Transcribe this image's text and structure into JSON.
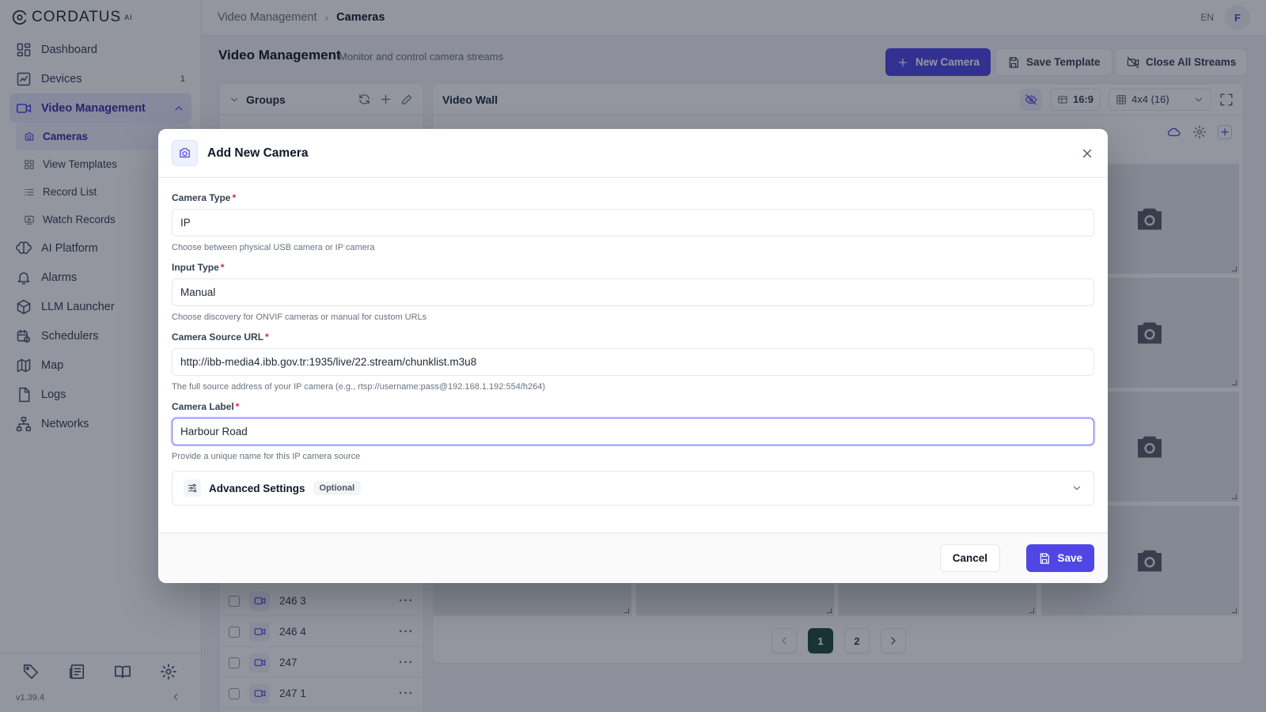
{
  "app": {
    "brand": "CORDATUS",
    "brand_sup": "AI",
    "version": "v1.39.4"
  },
  "sidebar": {
    "items": [
      {
        "label": "Dashboard",
        "icon": "dashboard-icon"
      },
      {
        "label": "Devices",
        "icon": "devices-icon",
        "badge": "1"
      },
      {
        "label": "Video Management",
        "icon": "video-icon",
        "active": true
      },
      {
        "label": "AI Platform",
        "icon": "brain-icon"
      },
      {
        "label": "Alarms",
        "icon": "bell-icon"
      },
      {
        "label": "LLM Launcher",
        "icon": "cube-icon"
      },
      {
        "label": "Schedulers",
        "icon": "calendar-clock-icon"
      },
      {
        "label": "Map",
        "icon": "map-icon"
      },
      {
        "label": "Logs",
        "icon": "file-icon"
      },
      {
        "label": "Networks",
        "icon": "network-icon"
      }
    ],
    "sub_items": [
      {
        "label": "Cameras",
        "icon": "camera-icon",
        "active": true
      },
      {
        "label": "View Templates",
        "icon": "grid-icon"
      },
      {
        "label": "Record List",
        "icon": "list-icon"
      },
      {
        "label": "Watch Records",
        "icon": "play-record-icon"
      }
    ]
  },
  "topbar": {
    "breadcrumb_parent": "Video Management",
    "breadcrumb_current": "Cameras",
    "lang": "EN",
    "avatar": "F"
  },
  "page": {
    "title": "Video Management",
    "subtitle": "Monitor and control camera streams",
    "new_camera": "New Camera",
    "save_template": "Save Template",
    "close_streams": "Close All Streams"
  },
  "groups": {
    "title": "Groups",
    "rows": [
      "246 3",
      "246 4",
      "247",
      "247 1"
    ]
  },
  "wall": {
    "title": "Video Wall",
    "aspect": "16:9",
    "layout": "4x4 (16)",
    "pages": [
      "1",
      "2"
    ],
    "current_page": "1"
  },
  "modal": {
    "title": "Add New Camera",
    "fields": {
      "camera_type": {
        "label": "Camera Type",
        "value": "IP",
        "help": "Choose between physical USB camera or IP camera"
      },
      "input_type": {
        "label": "Input Type",
        "value": "Manual",
        "help": "Choose discovery for ONVIF cameras or manual for custom URLs"
      },
      "source_url": {
        "label": "Camera Source URL",
        "value": "http://ibb-media4.ibb.gov.tr:1935/live/22.stream/chunklist.m3u8",
        "help": "The full source address of your IP camera (e.g., rtsp://username:pass@192.168.1.192:554/h264)"
      },
      "label": {
        "label": "Camera Label",
        "value": "Harbour Road",
        "help": "Provide a unique name for this IP camera source"
      }
    },
    "required_mark": "*",
    "advanced": {
      "title": "Advanced Settings",
      "badge": "Optional"
    },
    "cancel": "Cancel",
    "save": "Save"
  }
}
